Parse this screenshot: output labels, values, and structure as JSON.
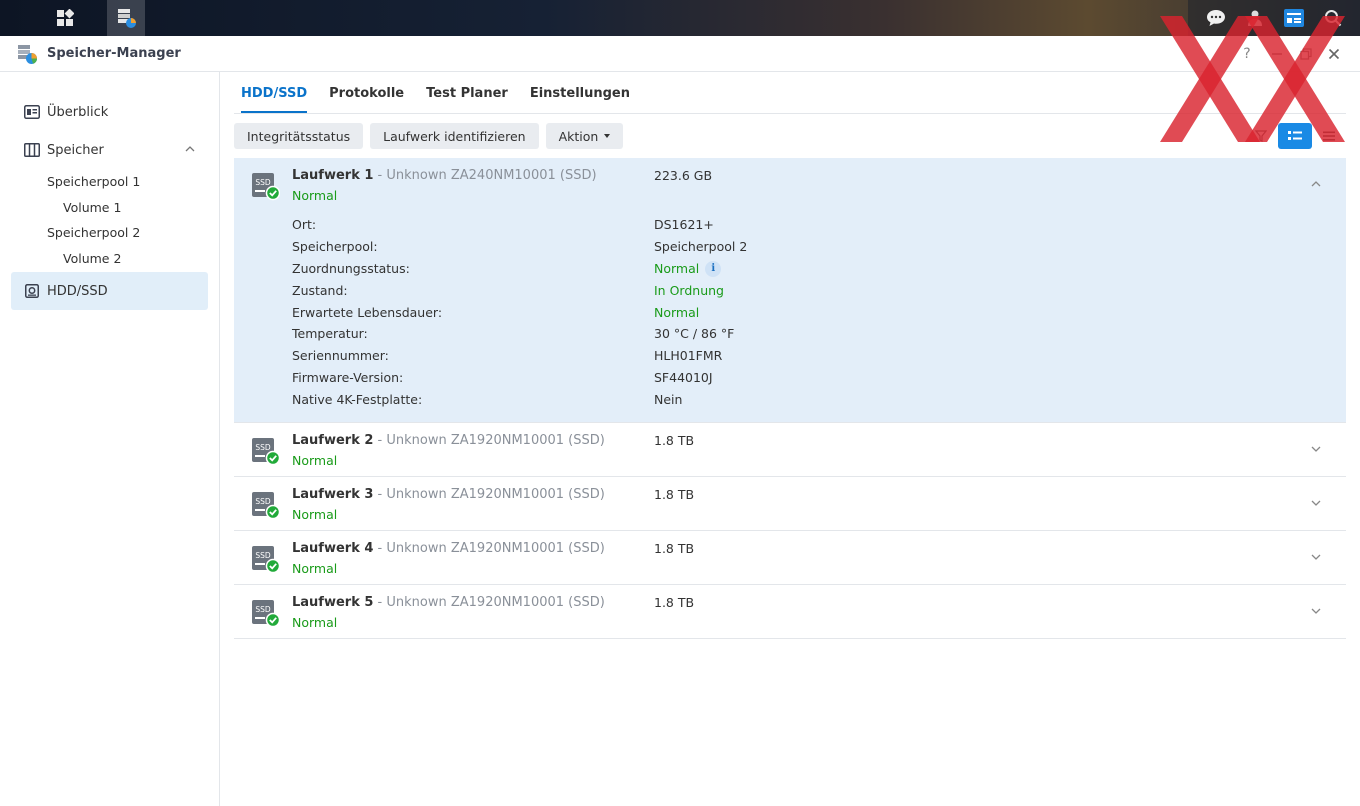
{
  "app": {
    "title": "Speicher-Manager"
  },
  "taskbar": {
    "icons": [
      "apps-grid-icon",
      "storage-manager-icon",
      "chat-icon",
      "user-icon",
      "widgets-icon",
      "search-icon"
    ]
  },
  "sidebar": {
    "items": [
      {
        "label": "Überblick",
        "icon": "overview-icon"
      },
      {
        "label": "Speicher",
        "icon": "storage-icon"
      },
      {
        "label": "HDD/SSD",
        "icon": "disk-icon"
      }
    ],
    "sub": {
      "pool1": "Speicherpool 1",
      "vol1": "Volume 1",
      "pool2": "Speicherpool 2",
      "vol2": "Volume 2"
    }
  },
  "tabs": [
    "HDD/SSD",
    "Protokolle",
    "Test Planer",
    "Einstellungen"
  ],
  "toolbar": {
    "integrity": "Integritätsstatus",
    "identify": "Laufwerk identifizieren",
    "action": "Aktion"
  },
  "drives": [
    {
      "name": "Laufwerk 1",
      "model": " - Unknown ZA240NM10001 (SSD)",
      "status": "Normal",
      "size": "223.6 GB"
    },
    {
      "name": "Laufwerk 2",
      "model": " - Unknown ZA1920NM10001 (SSD)",
      "status": "Normal",
      "size": "1.8 TB"
    },
    {
      "name": "Laufwerk 3",
      "model": " - Unknown ZA1920NM10001 (SSD)",
      "status": "Normal",
      "size": "1.8 TB"
    },
    {
      "name": "Laufwerk 4",
      "model": " - Unknown ZA1920NM10001 (SSD)",
      "status": "Normal",
      "size": "1.8 TB"
    },
    {
      "name": "Laufwerk 5",
      "model": " - Unknown ZA1920NM10001 (SSD)",
      "status": "Normal",
      "size": "1.8 TB"
    }
  ],
  "details": [
    {
      "key": "Ort:",
      "value": "DS1621+"
    },
    {
      "key": "Speicherpool:",
      "value": "Speicherpool 2"
    },
    {
      "key": "Zuordnungsstatus:",
      "value": "Normal"
    },
    {
      "key": "Zustand:",
      "value": "In Ordnung"
    },
    {
      "key": "Erwartete Lebensdauer:",
      "value": "Normal"
    },
    {
      "key": "Temperatur:",
      "value": "30 °C / 86 °F"
    },
    {
      "key": "Seriennummer:",
      "value": "HLH01FMR"
    },
    {
      "key": "Firmware-Version:",
      "value": "SF44010J"
    },
    {
      "key": "Native 4K-Festplatte:",
      "value": "Nein"
    }
  ],
  "ssd_label": "SSD",
  "info_glyph": "i",
  "colors": {
    "accent": "#0a73ca",
    "ok": "#1a9b1a",
    "selected_bg": "#e3eef9",
    "watermark": "#d9232e"
  }
}
